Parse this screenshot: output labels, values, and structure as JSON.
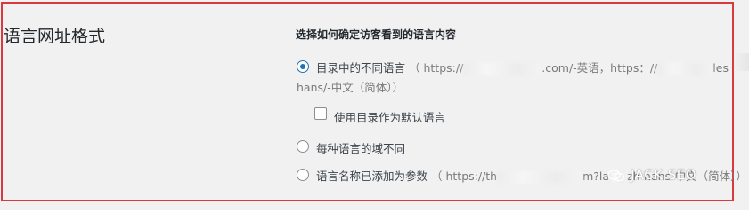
{
  "section": {
    "title": "语言网址格式"
  },
  "field": {
    "description": "选择如何确定访客看到的语言内容"
  },
  "options": [
    {
      "label": "目录中的不同语言",
      "example_part1": "（ https://",
      "example_part2": ".com/-英语，https：//",
      "example_part3": "les",
      "example_line2": "hans/-中文（简体））",
      "checked": true
    },
    {
      "label": "使用目录作为默认语言",
      "checked": false
    },
    {
      "label": "每种语言的域不同",
      "checked": false
    },
    {
      "label": "语言名称已添加为参数",
      "example_part1": "（ https://th",
      "example_part2": "m?la",
      "example_part3": "zh-hans-中文（简体））",
      "checked": false
    }
  ],
  "watermark": {
    "text": "JACK SEO",
    "icon": "wechat-icon"
  },
  "colors": {
    "accent": "#2271b1",
    "highlight_border": "#d9393f"
  }
}
